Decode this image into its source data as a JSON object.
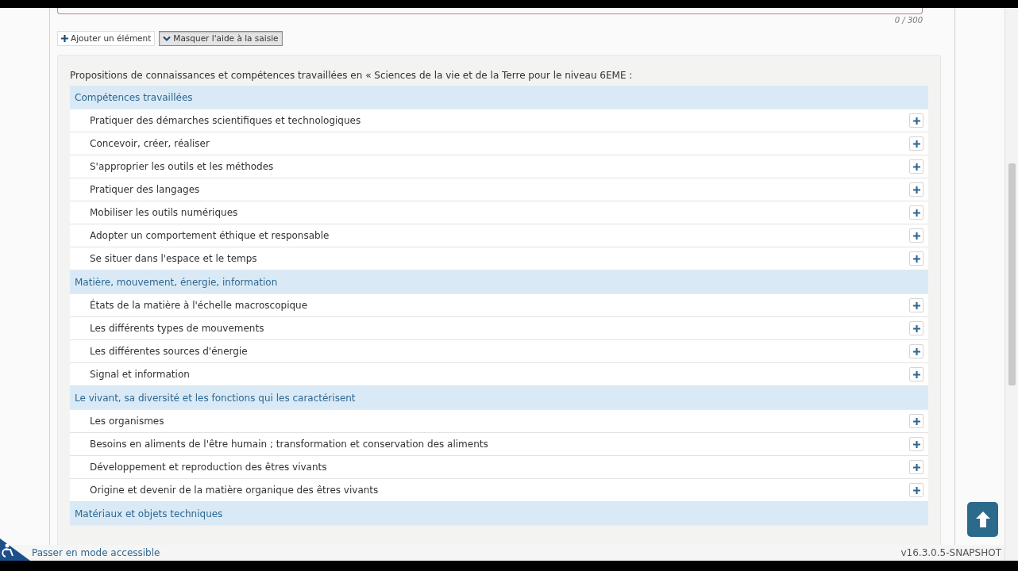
{
  "counter": "0 / 300",
  "buttons": [
    {
      "label": "Ajouter un élément",
      "kind": "add",
      "pressed": false
    },
    {
      "label": "Masquer l'aide à la saisie",
      "kind": "toggle",
      "pressed": true
    }
  ],
  "help": {
    "heading": "Propositions de connaissances et compétences travaillées en « Sciences de la vie et de la Terre pour le niveau 6EME :",
    "groups": [
      {
        "title": "Compétences travaillées",
        "items": [
          "Pratiquer des démarches scientifiques et technologiques",
          "Concevoir, créer, réaliser",
          "S'approprier les outils et les méthodes",
          "Pratiquer des langages",
          "Mobiliser les outils numériques",
          "Adopter un comportement éthique et responsable",
          "Se situer dans l'espace et le temps"
        ]
      },
      {
        "title": "Matière, mouvement, énergie, information",
        "items": [
          "États de la matière à l'échelle macroscopique",
          "Les différents types de mouvements",
          "Les différentes sources d'énergie",
          "Signal et information"
        ]
      },
      {
        "title": "Le vivant, sa diversité et les fonctions qui les caractérisent",
        "items": [
          "Les organismes",
          "Besoins en aliments de l'être humain ; transformation et conservation des aliments",
          "Développement et reproduction des êtres vivants",
          "Origine et devenir de la matière organique des êtres vivants"
        ]
      },
      {
        "title": "Matériaux et objets techniques"
      }
    ]
  },
  "footer": {
    "accessible_link": "Passer en mode accessible",
    "version": "v16.3.0.5-SNAPSHOT"
  }
}
